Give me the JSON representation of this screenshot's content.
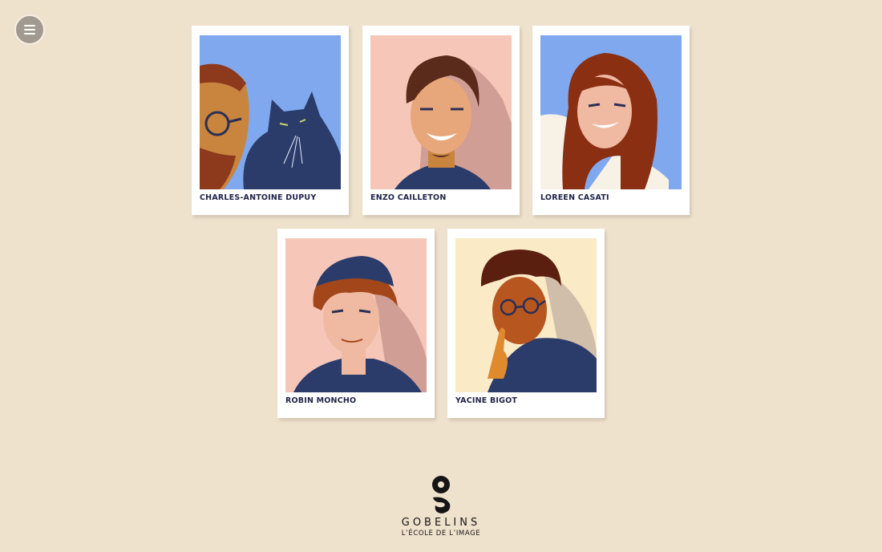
{
  "menu": {
    "icon": "hamburger-menu-icon"
  },
  "team": [
    {
      "name": "CHARLES-ANTOINE DUPUY",
      "bg": "#7fa8ee"
    },
    {
      "name": "ENZO CAILLETON",
      "bg": "#f6c7b8"
    },
    {
      "name": "LOREEN CASATI",
      "bg": "#7fa8ee"
    },
    {
      "name": "ROBIN MONCHO",
      "bg": "#f6c7b8"
    },
    {
      "name": "YACINE BIGOT",
      "bg": "#fbeac6"
    }
  ],
  "footer": {
    "logo_word": "GOBELINS",
    "logo_tagline": "L’ÉCOLE DE L’IMAGE"
  }
}
